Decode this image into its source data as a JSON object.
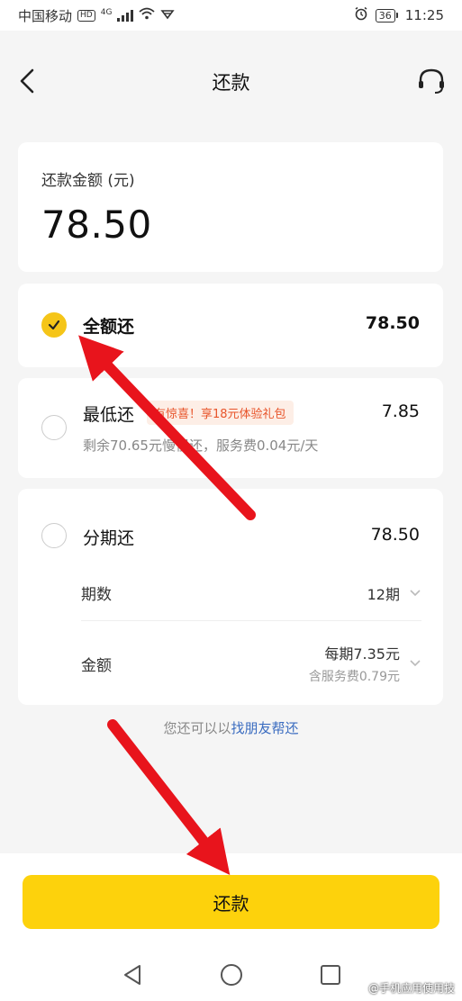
{
  "status_bar": {
    "carrier": "中国移动",
    "hd": "HD",
    "network": "4G",
    "battery": "36",
    "time": "11:25"
  },
  "header": {
    "title": "还款"
  },
  "amount": {
    "label": "还款金额 (元)",
    "value": "78.50"
  },
  "options": {
    "full": {
      "title": "全额还",
      "amount": "78.50",
      "selected": true
    },
    "minimum": {
      "title": "最低还",
      "amount": "7.85",
      "promo": "有惊喜！享18元体验礼包",
      "note": "剩余70.65元慢慢还，服务费0.04元/天"
    },
    "installment": {
      "title": "分期还",
      "amount": "78.50",
      "periods_label": "期数",
      "periods_value": "12期",
      "amount_label": "金额",
      "per_period": "每期7.35元",
      "fee_note": "含服务费0.79元"
    }
  },
  "friend_help": {
    "prefix": "您还可以以",
    "link": "找朋友帮还"
  },
  "submit_label": "还款",
  "watermark": "@手机应用使用技",
  "colors": {
    "accent": "#fdd20c",
    "check": "#f5c518",
    "promo_text": "#e8542a",
    "link": "#3a6cc0",
    "arrow": "#e8141c"
  }
}
